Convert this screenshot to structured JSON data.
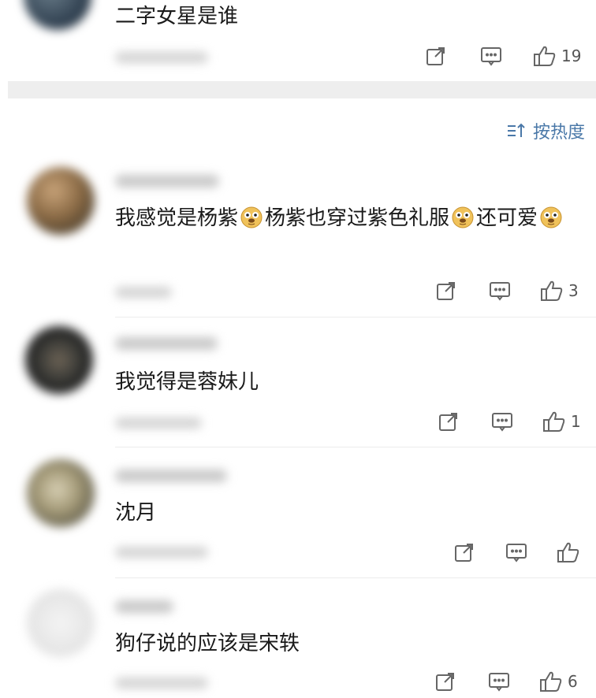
{
  "sort": {
    "label": "按热度"
  },
  "comments": [
    {
      "text": "二字女星是谁",
      "likes": "19"
    },
    {
      "segments": [
        "我感觉是杨紫",
        "杨紫也穿过紫色礼服",
        "还可爱"
      ],
      "likes": "3"
    },
    {
      "text": "我觉得是蓉妹儿",
      "likes": "1"
    },
    {
      "text": "沈月",
      "likes": ""
    },
    {
      "text": "狗仔说的应该是宋轶",
      "likes": "6"
    }
  ],
  "icons": {
    "share": "share-icon",
    "comment": "comment-icon",
    "like": "thumbs-up-icon",
    "emoji": "doge-emoji"
  }
}
